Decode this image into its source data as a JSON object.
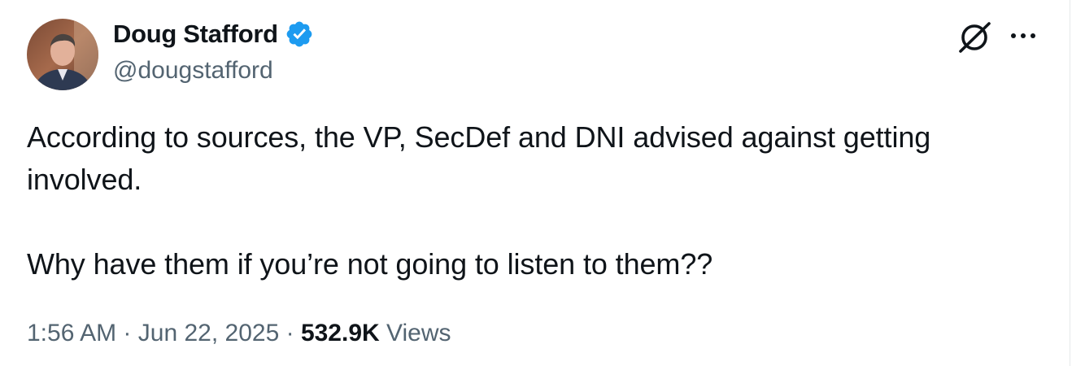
{
  "author": {
    "display_name": "Doug Stafford",
    "handle": "@dougstafford",
    "verified": true,
    "verified_color": "#1d9bf0"
  },
  "tweet": {
    "text_paragraph_1": "According to sources, the VP, SecDef and DNI advised against getting involved.",
    "text_paragraph_2": "Why have them if you’re not going to listen to them??"
  },
  "meta": {
    "time": "1:56 AM",
    "separator": "·",
    "date": "Jun 22, 2025",
    "views_count": "532.9K",
    "views_label": "Views"
  },
  "icons": {
    "grok": "grok-icon",
    "more": "more-options-icon",
    "verified": "verified-badge-icon"
  },
  "colors": {
    "text_primary": "#0f1419",
    "text_secondary": "#536471",
    "accent": "#1d9bf0"
  }
}
